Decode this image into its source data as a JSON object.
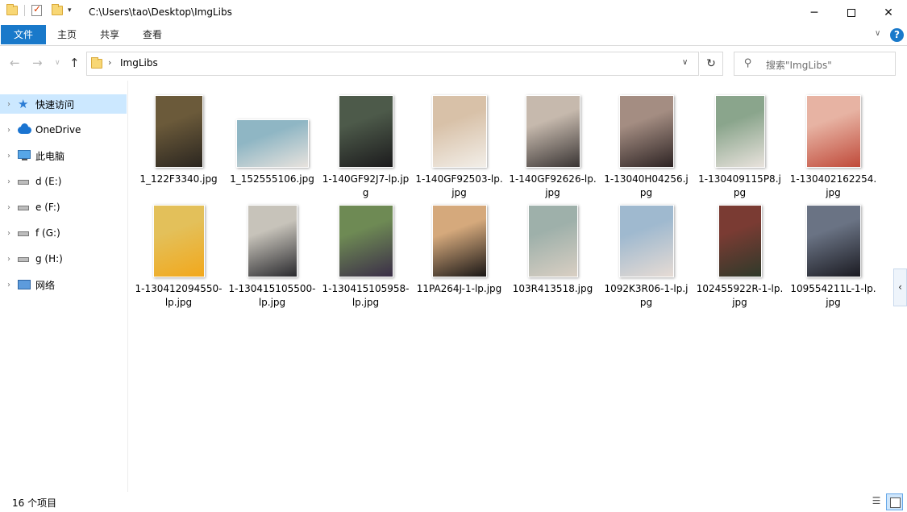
{
  "titlebar": {
    "path": "C:\\Users\\tao\\Desktop\\ImgLibs",
    "min_glyph": "─",
    "close_glyph": "✕"
  },
  "ribbon": {
    "tabs": [
      "文件",
      "主页",
      "共享",
      "查看"
    ],
    "help_glyph": "?",
    "expand_glyph": "∨",
    "accent_color": "#1979ca"
  },
  "nav": {
    "back_glyph": "←",
    "forward_glyph": "→",
    "recent_glyph": "∨",
    "up_glyph": "↑",
    "address_segment": "ImgLibs",
    "address_sep": "›",
    "dropdown_glyph": "∨",
    "refresh_glyph": "↻",
    "search_placeholder": "搜索\"ImgLibs\"",
    "search_glyph": "⚲"
  },
  "sidebar": {
    "items": [
      {
        "label": "快速访问",
        "icon": "quick-access-star-icon",
        "selected": true
      },
      {
        "label": "OneDrive",
        "icon": "onedrive-cloud-icon"
      },
      {
        "label": "此电脑",
        "icon": "this-pc-icon"
      },
      {
        "label": "d (E:)",
        "icon": "drive-icon"
      },
      {
        "label": "e (F:)",
        "icon": "drive-icon"
      },
      {
        "label": "f (G:)",
        "icon": "drive-icon"
      },
      {
        "label": "g (H:)",
        "icon": "drive-icon"
      },
      {
        "label": "网络",
        "icon": "network-icon"
      }
    ],
    "chevron_glyph": "›"
  },
  "files": [
    {
      "name": "1_122F3340.jpg",
      "colors": [
        "#6b5a3a",
        "#2b2620"
      ]
    },
    {
      "name": "1_152555106.jpg",
      "colors": [
        "#8fb6c4",
        "#e7e2dd"
      ]
    },
    {
      "name": "1-140GF92J7-lp.jpg",
      "colors": [
        "#4d5a4a",
        "#1c1b1d"
      ]
    },
    {
      "name": "1-140GF92503-lp.jpg",
      "colors": [
        "#d8c1a8",
        "#f2eee8"
      ]
    },
    {
      "name": "1-140GF92626-lp.jpg",
      "colors": [
        "#c6b9ad",
        "#3a3534"
      ]
    },
    {
      "name": "1-13040H04256.jpg",
      "colors": [
        "#a48d82",
        "#2e2424"
      ]
    },
    {
      "name": "1-130409115P8.jpg",
      "colors": [
        "#8aa58c",
        "#e8e2dc"
      ]
    },
    {
      "name": "1-130402162254.jpg",
      "colors": [
        "#e7b3a3",
        "#c04a3a"
      ]
    },
    {
      "name": "1-130412094550-lp.jpg",
      "colors": [
        "#e3c05a",
        "#f2a81c"
      ]
    },
    {
      "name": "1-130415105500-lp.jpg",
      "colors": [
        "#c7c3ba",
        "#2a2a2e"
      ]
    },
    {
      "name": "1-130415105958-lp.jpg",
      "colors": [
        "#6e8a54",
        "#3b2e48"
      ]
    },
    {
      "name": "11PA264J-1-lp.jpg",
      "colors": [
        "#d5a97c",
        "#1a1716"
      ]
    },
    {
      "name": "103R413518.jpg",
      "colors": [
        "#9eb0aa",
        "#d9cfc3"
      ]
    },
    {
      "name": "1092K3R06-1-lp.jpg",
      "colors": [
        "#9fb9cf",
        "#e6dbd4"
      ]
    },
    {
      "name": "102455922R-1-lp.jpg",
      "colors": [
        "#7a3b33",
        "#2f3a2a"
      ]
    },
    {
      "name": "109554211L-1-lp.jpg",
      "colors": [
        "#6a7384",
        "#1b1b22"
      ]
    }
  ],
  "pane_toggle_glyph": "‹",
  "status": {
    "item_count": "16 个项目",
    "details_glyph": "☰"
  }
}
